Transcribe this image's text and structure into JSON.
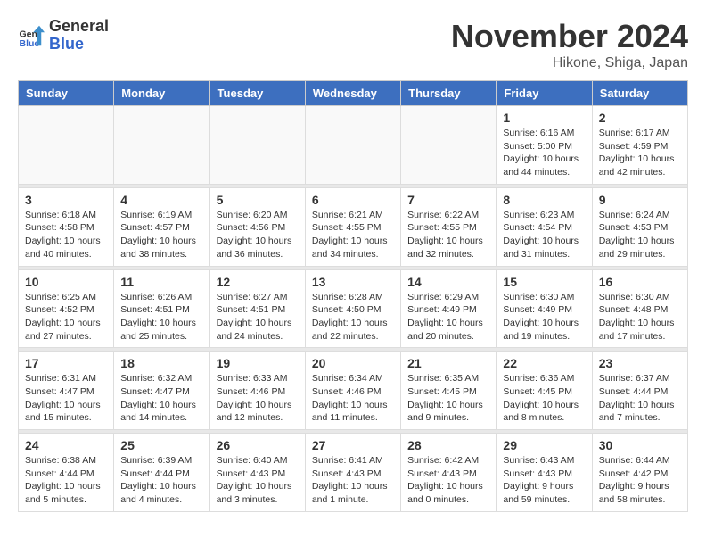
{
  "header": {
    "logo_general": "General",
    "logo_blue": "Blue",
    "month_title": "November 2024",
    "location": "Hikone, Shiga, Japan"
  },
  "days_of_week": [
    "Sunday",
    "Monday",
    "Tuesday",
    "Wednesday",
    "Thursday",
    "Friday",
    "Saturday"
  ],
  "weeks": [
    [
      {
        "day": "",
        "info": ""
      },
      {
        "day": "",
        "info": ""
      },
      {
        "day": "",
        "info": ""
      },
      {
        "day": "",
        "info": ""
      },
      {
        "day": "",
        "info": ""
      },
      {
        "day": "1",
        "info": "Sunrise: 6:16 AM\nSunset: 5:00 PM\nDaylight: 10 hours\nand 44 minutes."
      },
      {
        "day": "2",
        "info": "Sunrise: 6:17 AM\nSunset: 4:59 PM\nDaylight: 10 hours\nand 42 minutes."
      }
    ],
    [
      {
        "day": "3",
        "info": "Sunrise: 6:18 AM\nSunset: 4:58 PM\nDaylight: 10 hours\nand 40 minutes."
      },
      {
        "day": "4",
        "info": "Sunrise: 6:19 AM\nSunset: 4:57 PM\nDaylight: 10 hours\nand 38 minutes."
      },
      {
        "day": "5",
        "info": "Sunrise: 6:20 AM\nSunset: 4:56 PM\nDaylight: 10 hours\nand 36 minutes."
      },
      {
        "day": "6",
        "info": "Sunrise: 6:21 AM\nSunset: 4:55 PM\nDaylight: 10 hours\nand 34 minutes."
      },
      {
        "day": "7",
        "info": "Sunrise: 6:22 AM\nSunset: 4:55 PM\nDaylight: 10 hours\nand 32 minutes."
      },
      {
        "day": "8",
        "info": "Sunrise: 6:23 AM\nSunset: 4:54 PM\nDaylight: 10 hours\nand 31 minutes."
      },
      {
        "day": "9",
        "info": "Sunrise: 6:24 AM\nSunset: 4:53 PM\nDaylight: 10 hours\nand 29 minutes."
      }
    ],
    [
      {
        "day": "10",
        "info": "Sunrise: 6:25 AM\nSunset: 4:52 PM\nDaylight: 10 hours\nand 27 minutes."
      },
      {
        "day": "11",
        "info": "Sunrise: 6:26 AM\nSunset: 4:51 PM\nDaylight: 10 hours\nand 25 minutes."
      },
      {
        "day": "12",
        "info": "Sunrise: 6:27 AM\nSunset: 4:51 PM\nDaylight: 10 hours\nand 24 minutes."
      },
      {
        "day": "13",
        "info": "Sunrise: 6:28 AM\nSunset: 4:50 PM\nDaylight: 10 hours\nand 22 minutes."
      },
      {
        "day": "14",
        "info": "Sunrise: 6:29 AM\nSunset: 4:49 PM\nDaylight: 10 hours\nand 20 minutes."
      },
      {
        "day": "15",
        "info": "Sunrise: 6:30 AM\nSunset: 4:49 PM\nDaylight: 10 hours\nand 19 minutes."
      },
      {
        "day": "16",
        "info": "Sunrise: 6:30 AM\nSunset: 4:48 PM\nDaylight: 10 hours\nand 17 minutes."
      }
    ],
    [
      {
        "day": "17",
        "info": "Sunrise: 6:31 AM\nSunset: 4:47 PM\nDaylight: 10 hours\nand 15 minutes."
      },
      {
        "day": "18",
        "info": "Sunrise: 6:32 AM\nSunset: 4:47 PM\nDaylight: 10 hours\nand 14 minutes."
      },
      {
        "day": "19",
        "info": "Sunrise: 6:33 AM\nSunset: 4:46 PM\nDaylight: 10 hours\nand 12 minutes."
      },
      {
        "day": "20",
        "info": "Sunrise: 6:34 AM\nSunset: 4:46 PM\nDaylight: 10 hours\nand 11 minutes."
      },
      {
        "day": "21",
        "info": "Sunrise: 6:35 AM\nSunset: 4:45 PM\nDaylight: 10 hours\nand 9 minutes."
      },
      {
        "day": "22",
        "info": "Sunrise: 6:36 AM\nSunset: 4:45 PM\nDaylight: 10 hours\nand 8 minutes."
      },
      {
        "day": "23",
        "info": "Sunrise: 6:37 AM\nSunset: 4:44 PM\nDaylight: 10 hours\nand 7 minutes."
      }
    ],
    [
      {
        "day": "24",
        "info": "Sunrise: 6:38 AM\nSunset: 4:44 PM\nDaylight: 10 hours\nand 5 minutes."
      },
      {
        "day": "25",
        "info": "Sunrise: 6:39 AM\nSunset: 4:44 PM\nDaylight: 10 hours\nand 4 minutes."
      },
      {
        "day": "26",
        "info": "Sunrise: 6:40 AM\nSunset: 4:43 PM\nDaylight: 10 hours\nand 3 minutes."
      },
      {
        "day": "27",
        "info": "Sunrise: 6:41 AM\nSunset: 4:43 PM\nDaylight: 10 hours\nand 1 minute."
      },
      {
        "day": "28",
        "info": "Sunrise: 6:42 AM\nSunset: 4:43 PM\nDaylight: 10 hours\nand 0 minutes."
      },
      {
        "day": "29",
        "info": "Sunrise: 6:43 AM\nSunset: 4:43 PM\nDaylight: 9 hours\nand 59 minutes."
      },
      {
        "day": "30",
        "info": "Sunrise: 6:44 AM\nSunset: 4:42 PM\nDaylight: 9 hours\nand 58 minutes."
      }
    ]
  ]
}
